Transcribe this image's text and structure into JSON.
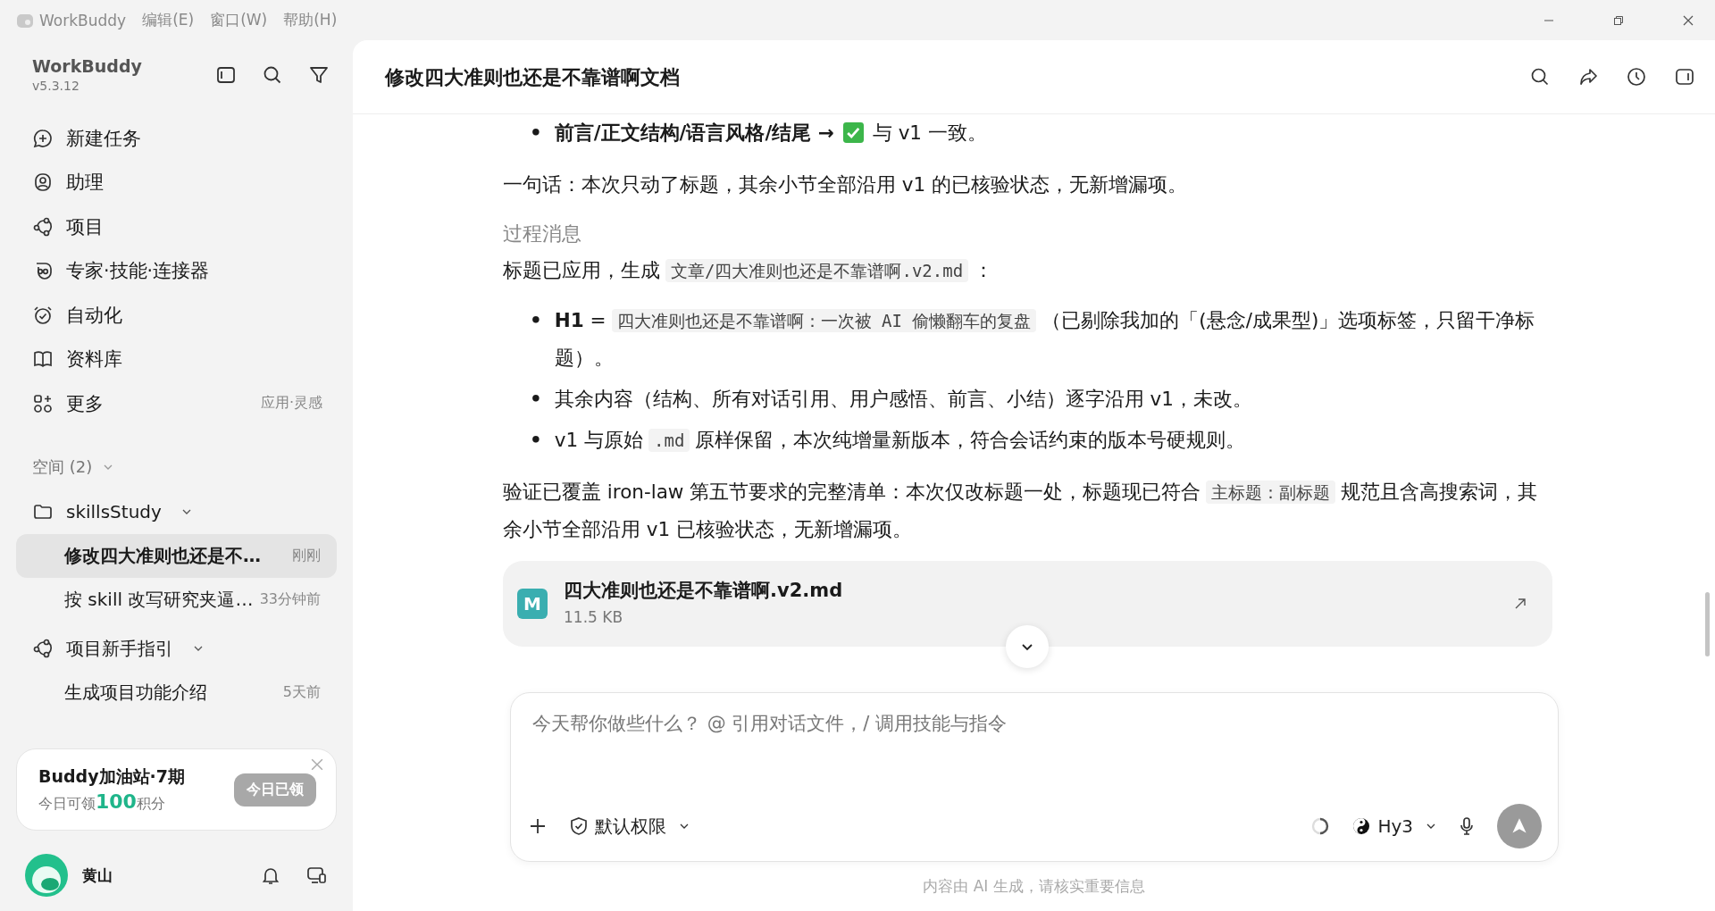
{
  "titlebar": {
    "app_name": "WorkBuddy",
    "menus": [
      "编辑(E)",
      "窗口(W)",
      "帮助(H)"
    ]
  },
  "sidebar": {
    "app_name": "WorkBuddy",
    "version": "v5.3.12",
    "nav": [
      {
        "label": "新建任务"
      },
      {
        "label": "助理"
      },
      {
        "label": "项目"
      },
      {
        "label": "专家·技能·连接器"
      },
      {
        "label": "自动化"
      },
      {
        "label": "资料库"
      },
      {
        "label": "更多",
        "hint": "应用·灵感"
      }
    ],
    "spaces_label": "空间 (2)",
    "spaces": [
      {
        "name": "skillsStudy",
        "expanded": true,
        "tasks": [
          {
            "title": "修改四大准则也还是不…",
            "time": "刚刚",
            "selected": true
          },
          {
            "title": "按 skill 改写研究夹逼…",
            "time": "33分钟前",
            "selected": false
          }
        ]
      },
      {
        "name": "项目新手指引",
        "expanded": true,
        "tasks": [
          {
            "title": "生成项目功能介绍",
            "time": "5天前",
            "selected": false
          }
        ]
      }
    ],
    "promo": {
      "title": "Buddy加油站·7期",
      "subtitle": "今日可领**100**积分",
      "button": "今日已领",
      "disabled": true
    },
    "user": {
      "name": "黄山"
    }
  },
  "chat": {
    "title": "修改四大准则也还是不靠谱啊文档",
    "blocks": [
      {
        "kind": "bullets",
        "marker": "•",
        "items": [
          [
            {
              "kind": "text",
              "text": "**前言/正文结构/语言风格/结尾 →**"
            },
            {
              "kind": "check"
            },
            {
              "kind": "text",
              "text": "与 v1 一致。"
            }
          ]
        ]
      },
      {
        "kind": "paragraph",
        "segments": [
          {
            "kind": "text",
            "text": "一句话：本次只动了标题，其余小节全部沿用 v1 的已核验状态，无新增漏项。"
          }
        ]
      },
      {
        "kind": "label",
        "text": "过程消息"
      },
      {
        "kind": "paragraph",
        "segments": [
          {
            "kind": "text",
            "text": "标题已应用，生成"
          },
          {
            "kind": "code",
            "text": "文章/四大准则也还是不靠谱啊.v2.md"
          },
          {
            "kind": "text",
            "text": "："
          }
        ]
      },
      {
        "kind": "bullets",
        "marker": "•",
        "items": [
          [
            {
              "kind": "text",
              "text": "**H1** ="
            },
            {
              "kind": "code",
              "text": "四大准则也还是不靠谱啊：一次被 AI 偷懒翻车的复盘"
            },
            {
              "kind": "text",
              "text": "（已剔除我加的「(悬念/成果型)」选项标签，只留干净标题）。"
            }
          ],
          [
            {
              "kind": "text",
              "text": "其余内容（结构、所有对话引用、用户感悟、前言、小结）逐字沿用 v1，未改。"
            }
          ],
          [
            {
              "kind": "text",
              "text": "v1 与原始"
            },
            {
              "kind": "code",
              "text": ".md"
            },
            {
              "kind": "text",
              "text": "原样保留，本次纯增量新版本，符合会话约束的版本号硬规则。"
            }
          ]
        ]
      },
      {
        "kind": "paragraph",
        "segments": [
          {
            "kind": "text",
            "text": "验证已覆盖 iron-law 第五节要求的完整清单：本次仅改标题一处，标题现已符合"
          },
          {
            "kind": "code",
            "text": "主标题：副标题"
          },
          {
            "kind": "text",
            "text": "规范且含高搜索词，其余小节全部沿用 v1 已核验状态，无新增漏项。"
          }
        ]
      }
    ],
    "file": {
      "badge": "M",
      "name": "四大准则也还是不靠谱啊.v2.md",
      "size": "11.5 KB"
    },
    "input": {
      "placeholder": "今天帮你做些什么？ @ 引用对话文件，/ 调用技能与指令",
      "permission": "默认权限",
      "model": "Hy3"
    },
    "footer": "内容由 AI 生成，请核实重要信息"
  }
}
